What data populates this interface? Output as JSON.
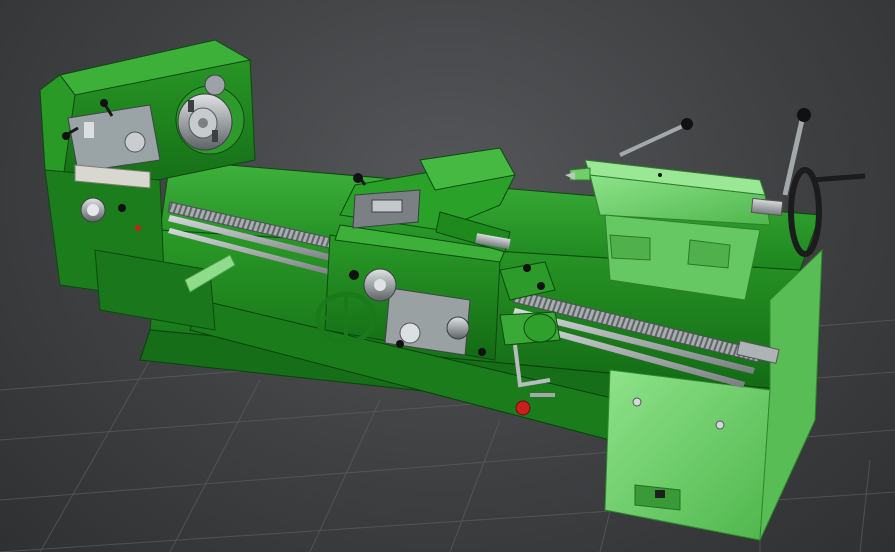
{
  "scene": {
    "subject": "lathe-3d-model",
    "colors": {
      "background": "#3e4042",
      "grid_line": "#5e6063",
      "body_green": "#1f8a1f",
      "body_dark": "#0f5512",
      "body_light": "#5cc45a",
      "tailstock_light": "#7fd97a",
      "metal": "#b9bdbf",
      "metal_dark": "#6f7477",
      "knob": "#1a1a1a",
      "knob_red": "#c81f1f"
    }
  }
}
